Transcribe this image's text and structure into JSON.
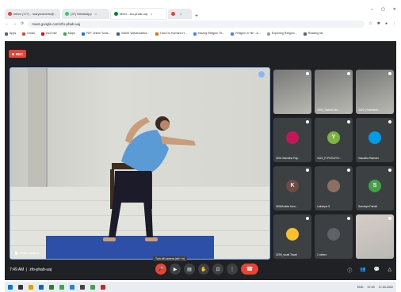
{
  "browser": {
    "tabs": [
      {
        "label": "Inbox (177) - marykroberts@... ",
        "active": false,
        "icon_color": "#ea4335"
      },
      {
        "label": "(37) WhatsApp",
        "active": false,
        "icon_color": "#25d366"
      },
      {
        "label": "Meet - zfo-phab-uaj",
        "active": true,
        "icon_color": "#00832d"
      },
      {
        "label": "",
        "active": false,
        "icon_color": "#ea4335"
      }
    ],
    "new_tab": "+",
    "window_controls": [
      "–",
      "▢",
      "✕"
    ],
    "url": "meet.google.com/zfo-phab-uaj",
    "bookmarks": [
      {
        "label": "Apps",
        "color": "#5f6368"
      },
      {
        "label": "Gmail",
        "color": "#ea4335"
      },
      {
        "label": "YouTube",
        "color": "#ff0000"
      },
      {
        "label": "Maps",
        "color": "#34a853"
      },
      {
        "label": "PDF Online Tools...",
        "color": "#1a73e8"
      },
      {
        "label": "BANS Vidhansabha...",
        "color": "#3b5998"
      },
      {
        "label": "How Do Humans H...",
        "color": "#e8710a"
      },
      {
        "label": "Having Religion Th...",
        "color": "#4285f4"
      },
      {
        "label": "Religion in Hin - A...",
        "color": "#4285f4"
      },
      {
        "label": "Exploring Religion...",
        "color": "#9aa0a6"
      },
      {
        "label": "Reading list",
        "color": "#5f6368"
      }
    ]
  },
  "meet": {
    "rec_label": "REC",
    "main_speaker": "Chitra Jadhav",
    "participants": [
      {
        "name": "",
        "type": "video",
        "initial": "",
        "color": "#777"
      },
      {
        "name": "3305_Sakshi Jad...",
        "type": "video",
        "initial": "",
        "color": "#777"
      },
      {
        "name": "3422_Rushikesh...",
        "type": "video",
        "initial": "",
        "color": "#777"
      },
      {
        "name": "3001 Manisha Raj...",
        "type": "avatar",
        "initial": "",
        "color": "#c2185b"
      },
      {
        "name": "3422_R.POOJITH...",
        "type": "avatar",
        "initial": "Y",
        "color": "#7cb342"
      },
      {
        "name": "Vasudha Ramani",
        "type": "avatar",
        "initial": "",
        "color": "#039be5"
      },
      {
        "name": "3006Ankita Kum...",
        "type": "avatar",
        "initial": "K",
        "color": "#6d4c41"
      },
      {
        "name": "Lakshya G",
        "type": "avatar",
        "initial": "",
        "color": "#8d6e63"
      },
      {
        "name": "Sandhya Pandit",
        "type": "avatar",
        "initial": "S",
        "color": "#43a047"
      },
      {
        "name": "3299_swati Tiwari",
        "type": "avatar",
        "initial": "",
        "color": "#fbc02d"
      },
      {
        "name": "2 others",
        "type": "others",
        "initial": "",
        "color": "#5f6368"
      },
      {
        "name": "",
        "type": "video",
        "initial": "",
        "color": "#d7ccc8"
      }
    ],
    "time": "7:49 AM",
    "meeting_code": "zfo-phab-uaj",
    "tooltip": "Turn off camera (ctrl + e)",
    "controls": [
      "🎤",
      "▶",
      "▤",
      "✋",
      "⊡",
      "⋮"
    ],
    "end_call": "☎",
    "right_icons": [
      "ⓘ",
      "👥",
      "💬",
      "△"
    ]
  },
  "taskbar": {
    "tray_time": "07:49",
    "tray_date": "17-03-2022",
    "lang": "ENG",
    "icon_colors": [
      "#0078d7",
      "#333",
      "#e1a100",
      "#0a66c2",
      "#2e7d32",
      "#34a853",
      "#1e88e5",
      "#444",
      "#43a047",
      "#c62828"
    ]
  }
}
